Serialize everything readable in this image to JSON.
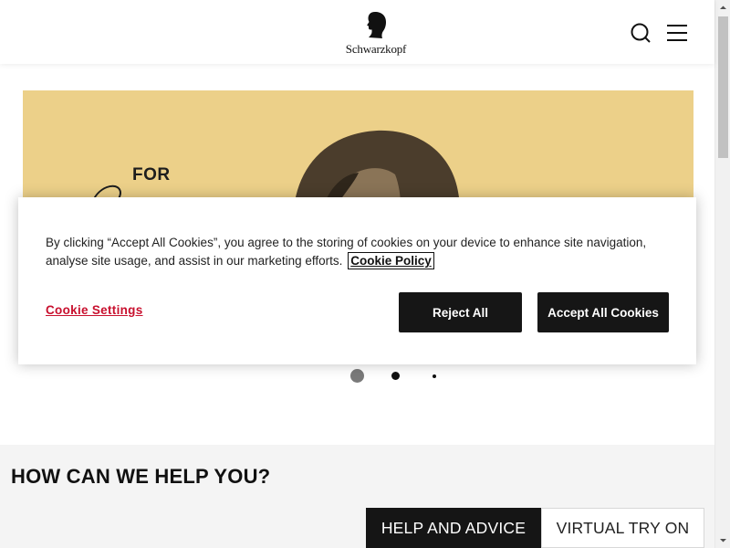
{
  "header": {
    "brand": "Schwarzkopf",
    "search_icon": "search-icon",
    "menu_icon": "hamburger-menu-icon"
  },
  "hero": {
    "headline_word": "FOR",
    "carousel": {
      "slide_count": 3,
      "active_index": 0
    }
  },
  "cookie_banner": {
    "message": "By clicking “Accept All Cookies”, you agree to the storing of cookies on your device to enhance site navigation, analyse site usage, and assist in our marketing efforts.",
    "policy_link": "Cookie Policy",
    "settings_label": "Cookie Settings",
    "reject_label": "Reject All",
    "accept_label": "Accept All Cookies"
  },
  "help": {
    "title": "HOW CAN WE HELP YOU?",
    "tabs": [
      {
        "label": "HELP AND ADVICE",
        "active": true
      },
      {
        "label": "VIRTUAL TRY ON",
        "active": false
      }
    ]
  },
  "colors": {
    "hero_bg": "#ecd089",
    "cookie_settings_link": "#c8102e",
    "button_dark": "#161616",
    "section_bg": "#f4f4f4"
  }
}
